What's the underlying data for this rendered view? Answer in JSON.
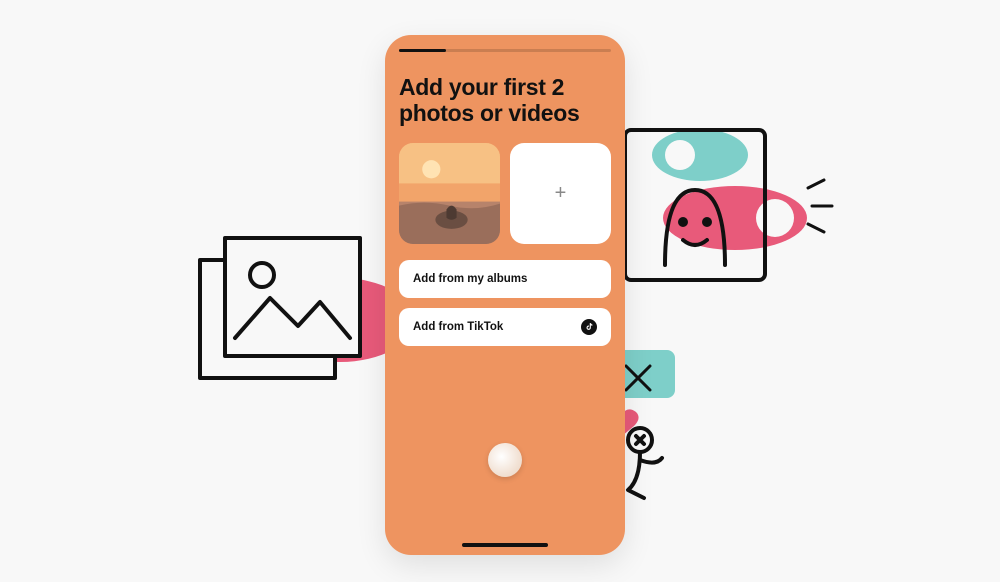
{
  "screen": {
    "title": "Add your first 2 photos or videos",
    "progress_percent": 22,
    "media_slots": [
      {
        "state": "filled",
        "alt": "sunset-ocean-photo"
      },
      {
        "state": "empty",
        "icon": "plus"
      }
    ],
    "options": [
      {
        "label": "Add from my albums",
        "icon": null
      },
      {
        "label": "Add from TikTok",
        "icon": "tiktok"
      }
    ]
  },
  "colors": {
    "phone_bg": "#ee9460",
    "accent_pink": "#e85a7a",
    "accent_teal": "#7ecfc9"
  }
}
